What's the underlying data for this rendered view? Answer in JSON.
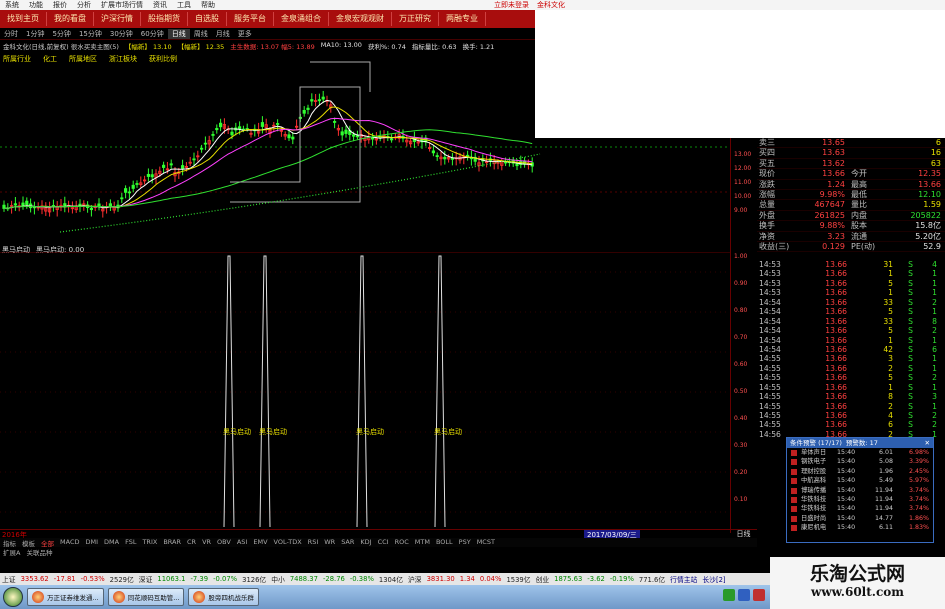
{
  "menu": [
    "系统",
    "功能",
    "报价",
    "分析",
    "扩展市场行情",
    "资讯",
    "工具",
    "帮助"
  ],
  "menu_right": [
    "立即未登录",
    "金科文化"
  ],
  "nav": [
    "找到主页",
    "我的看盘",
    "沪深行情",
    "股指期货",
    "自选股",
    "服务平台",
    "金泉涌组合",
    "金泉宏观观财",
    "万正研究",
    "两融专业"
  ],
  "periods": [
    "分时",
    "1分钟",
    "5分钟",
    "15分钟",
    "30分钟",
    "60分钟",
    "日线",
    "周线",
    "月线",
    "更多"
  ],
  "period_active": "日线",
  "info": {
    "name": "金科文化(日线,前复权) 很水买卖主图(5)",
    "flag": "【幅新】 13.10",
    "flag2": "【幅新】 12.35",
    "ma": "主生数据: 13.07 幅5: 13.89",
    "ma2": "MA10: 13.00",
    "extra1": "获利%: 0.74",
    "extra2": "指标量比: 0.63",
    "extra3": "换手: 1.21"
  },
  "tags": [
    "所属行业",
    "化工",
    "所属地区",
    "浙江板块",
    "获利比例"
  ],
  "lower_label": [
    "黑马启动",
    "黑马启动: 0.00"
  ],
  "signal_label": "黑马启动",
  "main_axis_labels": [
    "13.00",
    "12.00",
    "11.00",
    "10.00",
    "9.00"
  ],
  "sub_axis_labels": [
    "1.00",
    "0.90",
    "0.80",
    "0.70",
    "0.60",
    "0.50",
    "0.40",
    "0.30",
    "0.20",
    "0.10"
  ],
  "quote": [
    {
      "l": "卖三",
      "v1": "13.65",
      "l2": "",
      "v2": "6",
      "c2": "yl"
    },
    {
      "l": "买四",
      "v1": "13.63",
      "l2": "",
      "v2": "16",
      "c2": "yl"
    },
    {
      "l": "买五",
      "v1": "13.62",
      "l2": "",
      "v2": "63",
      "c2": "yl"
    },
    {
      "l": "现价",
      "v1": "13.66",
      "l2": "今开",
      "v2": "12.35",
      "c2": ""
    },
    {
      "l": "涨跌",
      "v1": "1.24",
      "l2": "最高",
      "v2": "13.66",
      "c2": ""
    },
    {
      "l": "涨幅",
      "v1": "9.98%",
      "l2": "最低",
      "v2": "12.10",
      "c2": "g"
    },
    {
      "l": "总量",
      "v1": "467647",
      "l2": "量比",
      "v2": "1.59",
      "c2": "yl"
    },
    {
      "l": "外盘",
      "v1": "261825",
      "l2": "内盘",
      "v2": "205822",
      "c2": "g"
    },
    {
      "l": "换手",
      "v1": "9.88%",
      "l2": "股本",
      "v2": "15.8亿",
      "c2": "w"
    },
    {
      "l": "净资",
      "v1": "3.23",
      "l2": "流通",
      "v2": "5.20亿",
      "c2": "w"
    },
    {
      "l": "收益(三)",
      "v1": "0.129",
      "l2": "PE(动)",
      "v2": "52.9",
      "c2": "w"
    }
  ],
  "ticks": [
    {
      "t": "14:53",
      "p": "13.66",
      "vol": "31",
      "bs": "S",
      "n": "4"
    },
    {
      "t": "14:53",
      "p": "13.66",
      "vol": "1",
      "bs": "S",
      "n": "1"
    },
    {
      "t": "14:53",
      "p": "13.66",
      "vol": "5",
      "bs": "S",
      "n": "1"
    },
    {
      "t": "14:53",
      "p": "13.66",
      "vol": "1",
      "bs": "S",
      "n": "1"
    },
    {
      "t": "14:54",
      "p": "13.66",
      "vol": "33",
      "bs": "S",
      "n": "2"
    },
    {
      "t": "14:54",
      "p": "13.66",
      "vol": "5",
      "bs": "S",
      "n": "1"
    },
    {
      "t": "14:54",
      "p": "13.66",
      "vol": "33",
      "bs": "S",
      "n": "8"
    },
    {
      "t": "14:54",
      "p": "13.66",
      "vol": "5",
      "bs": "S",
      "n": "2"
    },
    {
      "t": "14:54",
      "p": "13.66",
      "vol": "1",
      "bs": "S",
      "n": "1"
    },
    {
      "t": "14:54",
      "p": "13.66",
      "vol": "42",
      "bs": "S",
      "n": "6"
    },
    {
      "t": "14:55",
      "p": "13.66",
      "vol": "3",
      "bs": "S",
      "n": "1"
    },
    {
      "t": "14:55",
      "p": "13.66",
      "vol": "2",
      "bs": "S",
      "n": "1"
    },
    {
      "t": "14:55",
      "p": "13.66",
      "vol": "5",
      "bs": "S",
      "n": "2"
    },
    {
      "t": "14:55",
      "p": "13.66",
      "vol": "1",
      "bs": "S",
      "n": "1"
    },
    {
      "t": "14:55",
      "p": "13.66",
      "vol": "8",
      "bs": "S",
      "n": "3"
    },
    {
      "t": "14:55",
      "p": "13.66",
      "vol": "2",
      "bs": "S",
      "n": "1"
    },
    {
      "t": "14:55",
      "p": "13.66",
      "vol": "4",
      "bs": "S",
      "n": "2"
    },
    {
      "t": "14:55",
      "p": "13.66",
      "vol": "6",
      "bs": "S",
      "n": "2"
    },
    {
      "t": "14:56",
      "p": "13.66",
      "vol": "2",
      "bs": "S",
      "n": "1"
    }
  ],
  "popup": {
    "title": "条件预警 (17/17)",
    "title2": "预警数: 17",
    "rows": [
      {
        "nm": "单体声日",
        "tm": "15:40",
        "pr": "6.01",
        "pc": "6.98%"
      },
      {
        "nm": "钢铁电子",
        "tm": "15:40",
        "pr": "5.08",
        "pc": "3.39%"
      },
      {
        "nm": "理财控股",
        "tm": "15:40",
        "pr": "1.96",
        "pc": "2.45%"
      },
      {
        "nm": "中航高科",
        "tm": "15:40",
        "pr": "5.49",
        "pc": "5.97%"
      },
      {
        "nm": "博瑞传播",
        "tm": "15:40",
        "pr": "11.94",
        "pc": "3.74%"
      },
      {
        "nm": "华铁科技",
        "tm": "15:40",
        "pr": "11.94",
        "pc": "3.74%"
      },
      {
        "nm": "华铁科技",
        "tm": "15:40",
        "pr": "11.94",
        "pc": "3.74%"
      },
      {
        "nm": "日盛时尚",
        "tm": "15:40",
        "pr": "14.77",
        "pc": "1.86%"
      },
      {
        "nm": "康尼机电",
        "tm": "15:40",
        "pr": "6.11",
        "pc": "1.83%"
      }
    ]
  },
  "date_label": "2017/03/09/三",
  "day_button": "日线",
  "date_axis_left": "2016年",
  "indicators": [
    "指标",
    "模板",
    "全部",
    "MACD",
    "DMI",
    "DMA",
    "FSL",
    "TRIX",
    "BRAR",
    "CR",
    "VR",
    "OBV",
    "ASI",
    "EMV",
    "VOL-TDX",
    "RSI",
    "WR",
    "SAR",
    "KDJ",
    "CCI",
    "ROC",
    "MTM",
    "BOLL",
    "PSY",
    "MCST"
  ],
  "indicator_active": "全部",
  "subtabs": [
    "扩展A",
    "关联品种"
  ],
  "status": {
    "sh_label": "上证",
    "sh": "3353.62",
    "sh_chg": "-17.81",
    "sh_pct": "-0.53%",
    "sh_amt": "2529亿",
    "sz_label": "深证",
    "sz": "11063.1",
    "sz_chg": "-7.39",
    "sz_pct": "-0.07%",
    "sz_amt": "3126亿",
    "zx_label": "中小",
    "zx": "7488.37",
    "zx_chg": "-28.76",
    "zx_pct": "-0.38%",
    "zx_amt": "1304亿",
    "hs_label": "沪深",
    "hs": "3831.30",
    "hs_chg": "1.34",
    "hs_pct": "0.04%",
    "hs_amt": "1539亿",
    "cy_label": "创业",
    "cy": "1875.63",
    "cy_chg": "-3.62",
    "cy_pct": "-0.19%",
    "cy_amt": "771.6亿",
    "server": "行情主站",
    "server2": "长沙[2]"
  },
  "taskbar": [
    "万正证券维发通...",
    "同花顺码互助管...",
    "股旁四机战乐群"
  ],
  "watermark": {
    "title": "乐淘公式网",
    "url": "www.60lt.com"
  },
  "colors": {
    "up": "#ff4040",
    "down": "#30e030",
    "nav_bg": "#a80d0d",
    "accent": "#e8e000"
  }
}
